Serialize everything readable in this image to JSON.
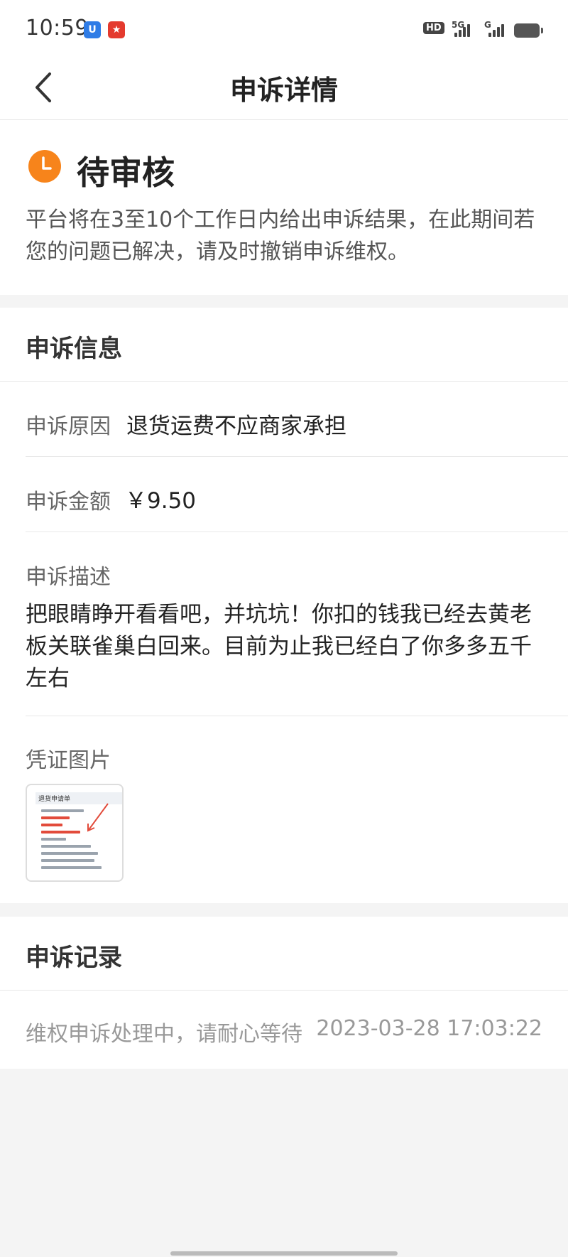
{
  "status_bar": {
    "time": "10:59",
    "hd_label": "HD",
    "net_5g": "5G",
    "net_g": "G"
  },
  "nav": {
    "title": "申诉详情",
    "back_icon": "chevron-left-icon"
  },
  "status": {
    "title": "待审核",
    "description": "平台将在3至10个工作日内给出申诉结果，在此期间若您的问题已解决，请及时撤销申诉维权。",
    "icon": "clock-icon",
    "accent_color": "#f7841b"
  },
  "info": {
    "section_title": "申诉信息",
    "reason_label": "申诉原因",
    "reason_value": "退货运费不应商家承担",
    "amount_label": "申诉金额",
    "amount_value": "￥9.50",
    "description_label": "申诉描述",
    "description_value": "把眼睛睁开看看吧，并坑坑！你扣的钱我已经去黄老板关联雀巢白回来。目前为止我已经白了你多多五千左右",
    "evidence_label": "凭证图片",
    "evidence_thumb_title": "退货申请单"
  },
  "record": {
    "section_title": "申诉记录",
    "entry_text": "维权申诉处理中，请耐心等待",
    "entry_time": "2023-03-28 17:03:22"
  }
}
